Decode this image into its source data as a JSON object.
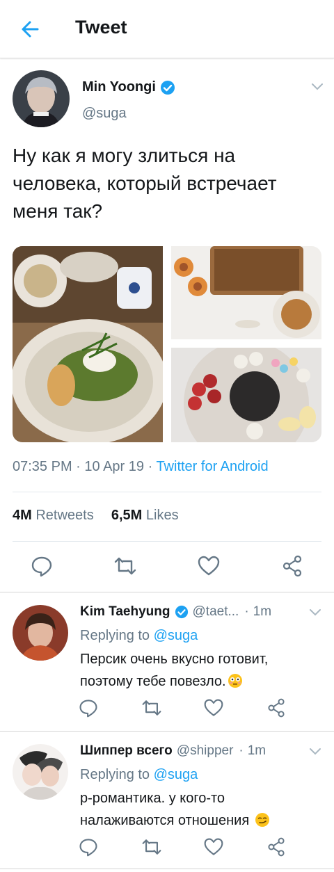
{
  "header": {
    "title": "Tweet"
  },
  "tweet": {
    "author_name": "Min Yoongi",
    "author_handle": "@suga",
    "text": "Ну как я могу злиться на человека, который встречает меня так?",
    "time": "07:35 PM",
    "date": "10 Apr 19",
    "source": "Twitter for Android",
    "retweets_count": "4M",
    "retweets_label": "Retweets",
    "likes_count": "6,5M",
    "likes_label": "Likes"
  },
  "replies": [
    {
      "author_name": "Kim Taehyung",
      "author_handle": "@taet...",
      "time": "1m",
      "replying_label": "Replying to",
      "replying_handle": "@suga",
      "text": "Персик очень вкусно готовит, поэтому тебе повезло.",
      "verified": true,
      "emoji": "flushed-face"
    },
    {
      "author_name": "Шиппер всего",
      "author_handle": "@shipper",
      "time": "1m",
      "replying_label": "Replying to",
      "replying_handle": "@suga",
      "text": "р-романтика. у кого-то налаживаются отношения",
      "verified": false,
      "emoji": "smirking-face"
    }
  ],
  "colors": {
    "accent": "#1da1f2",
    "text": "#14171a",
    "muted": "#657786",
    "divider": "#e1e8ed"
  }
}
